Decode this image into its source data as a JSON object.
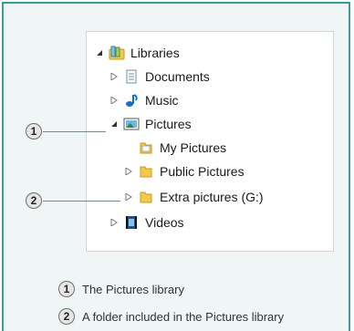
{
  "tree": {
    "libraries": "Libraries",
    "documents": "Documents",
    "music": "Music",
    "pictures": "Pictures",
    "my_pictures": "My Pictures",
    "public_pictures": "Public Pictures",
    "extra_pictures": "Extra pictures (G:)",
    "videos": "Videos"
  },
  "callouts": [
    {
      "number": "1",
      "text": "The Pictures library"
    },
    {
      "number": "2",
      "text": "A folder included in the Pictures library"
    }
  ],
  "colors": {
    "frame_border": "#3d9b93",
    "frame_background": "#f0f6f6"
  }
}
